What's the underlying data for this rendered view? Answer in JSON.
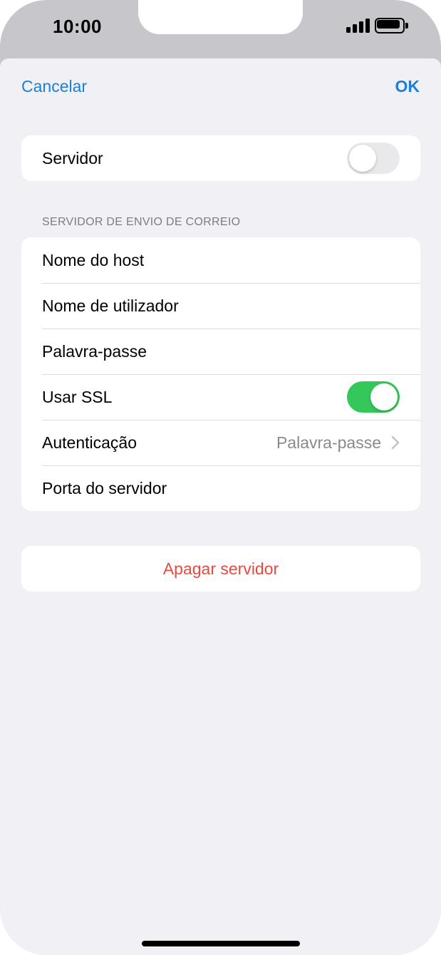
{
  "status_bar": {
    "time": "10:00",
    "icons": [
      "signal-icon",
      "battery-icon"
    ]
  },
  "nav": {
    "cancel_label": "Cancelar",
    "ok_label": "OK"
  },
  "server_toggle": {
    "label": "Servidor",
    "enabled": false
  },
  "outgoing_section": {
    "header": "SERVIDOR DE ENVIO DE CORREIO",
    "rows": [
      {
        "label": "Nome do host"
      },
      {
        "label": "Nome de utilizador"
      },
      {
        "label": "Palavra-passe"
      },
      {
        "label": "Usar SSL",
        "toggle": true
      },
      {
        "label": "Autenticação",
        "value": "Palavra-passe",
        "icon": "chevron-right-icon"
      },
      {
        "label": "Porta do servidor"
      }
    ]
  },
  "delete_button": {
    "label": "Apagar servidor"
  },
  "colors": {
    "accent": "#1a7fd6",
    "toggle_on": "#34c759",
    "destructive": "#e84a3f",
    "background": "#f0f0f5"
  }
}
